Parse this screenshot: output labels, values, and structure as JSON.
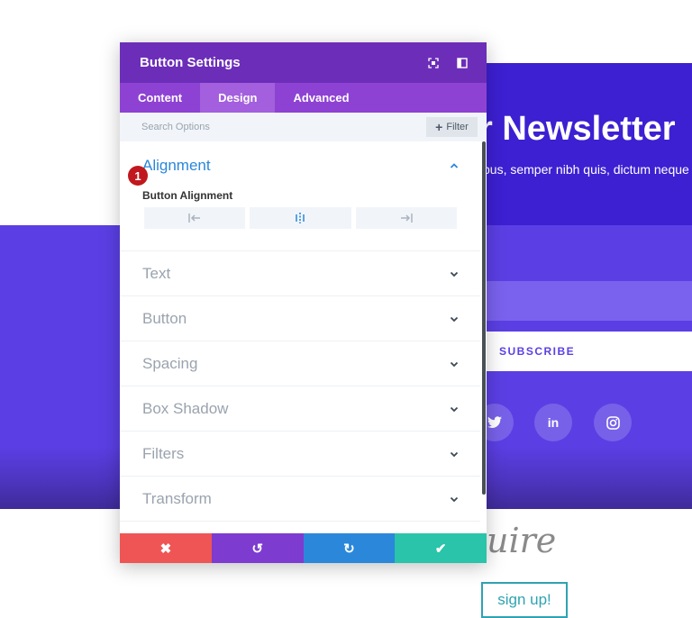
{
  "background": {
    "title": "r Newsletter",
    "subtitle": "pus, semper nibh quis, dictum neque",
    "subscribe_label": "SUBSCRIBE",
    "social_icons": [
      {
        "icon": "twitter-icon",
        "glyph": "🐦"
      },
      {
        "icon": "linkedin-icon",
        "glyph": "in"
      },
      {
        "icon": "instagram-icon",
        "glyph": "◎"
      }
    ],
    "script_text": "uire",
    "signup_label": "sign up!"
  },
  "modal": {
    "title": "Button Settings",
    "tabs": [
      {
        "label": "Content",
        "active": false
      },
      {
        "label": "Design",
        "active": true
      },
      {
        "label": "Advanced",
        "active": false
      }
    ],
    "search_placeholder": "Search Options",
    "filter_label": "Filter",
    "sections": {
      "alignment": {
        "title": "Alignment",
        "field_label": "Button Alignment",
        "badge": "1"
      },
      "text": {
        "title": "Text"
      },
      "button": {
        "title": "Button"
      },
      "spacing": {
        "title": "Spacing"
      },
      "box_shadow": {
        "title": "Box Shadow"
      },
      "filters": {
        "title": "Filters"
      },
      "transform": {
        "title": "Transform"
      }
    },
    "footer": {
      "discard": "✖",
      "undo": "↺",
      "redo": "↻",
      "save": "✔"
    }
  },
  "colors": {
    "header": "#6c2eb9",
    "tabs": "#8e42d3",
    "accent": "#2b87da",
    "discard": "#ef5555",
    "undo": "#7e3bd0",
    "redo": "#2b87da",
    "save": "#29c4a9",
    "hero": "#5b3fe4"
  }
}
